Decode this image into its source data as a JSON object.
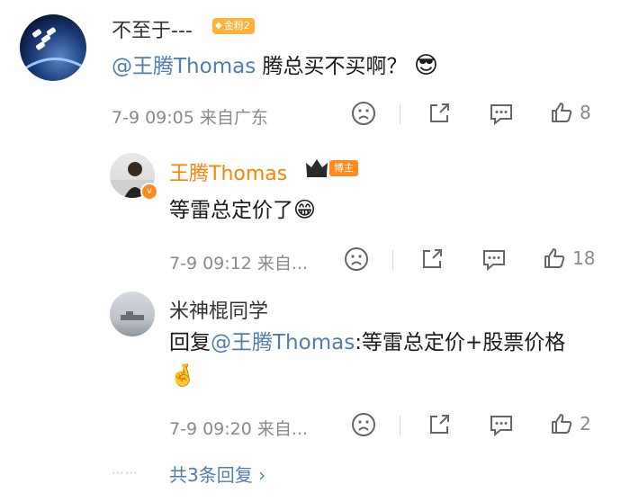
{
  "comment": {
    "username": "不至于---",
    "badge": "金粉2",
    "text_mention": "@王腾Thomas",
    "text_body": " 腾总买不买啊？",
    "emoji": "😎",
    "meta": "7-9 09:05  来自广东",
    "like_count": "8"
  },
  "replies": [
    {
      "username": "王腾Thomas",
      "badge": "博主",
      "text": "等雷总定价了",
      "emoji": "😁",
      "meta": "7-9 09:12  来自...",
      "like_count": "18"
    },
    {
      "username": "米神棍同学",
      "text_prefix": "回复",
      "text_mention": "@王腾Thomas",
      "text_body": ":等雷总定价+股票价格",
      "emoji": "🤞",
      "meta": "7-9 09:20  来自...",
      "like_count": "2"
    }
  ],
  "more_replies": {
    "dots": "⋯⋯",
    "label": "共3条回复 ›"
  }
}
